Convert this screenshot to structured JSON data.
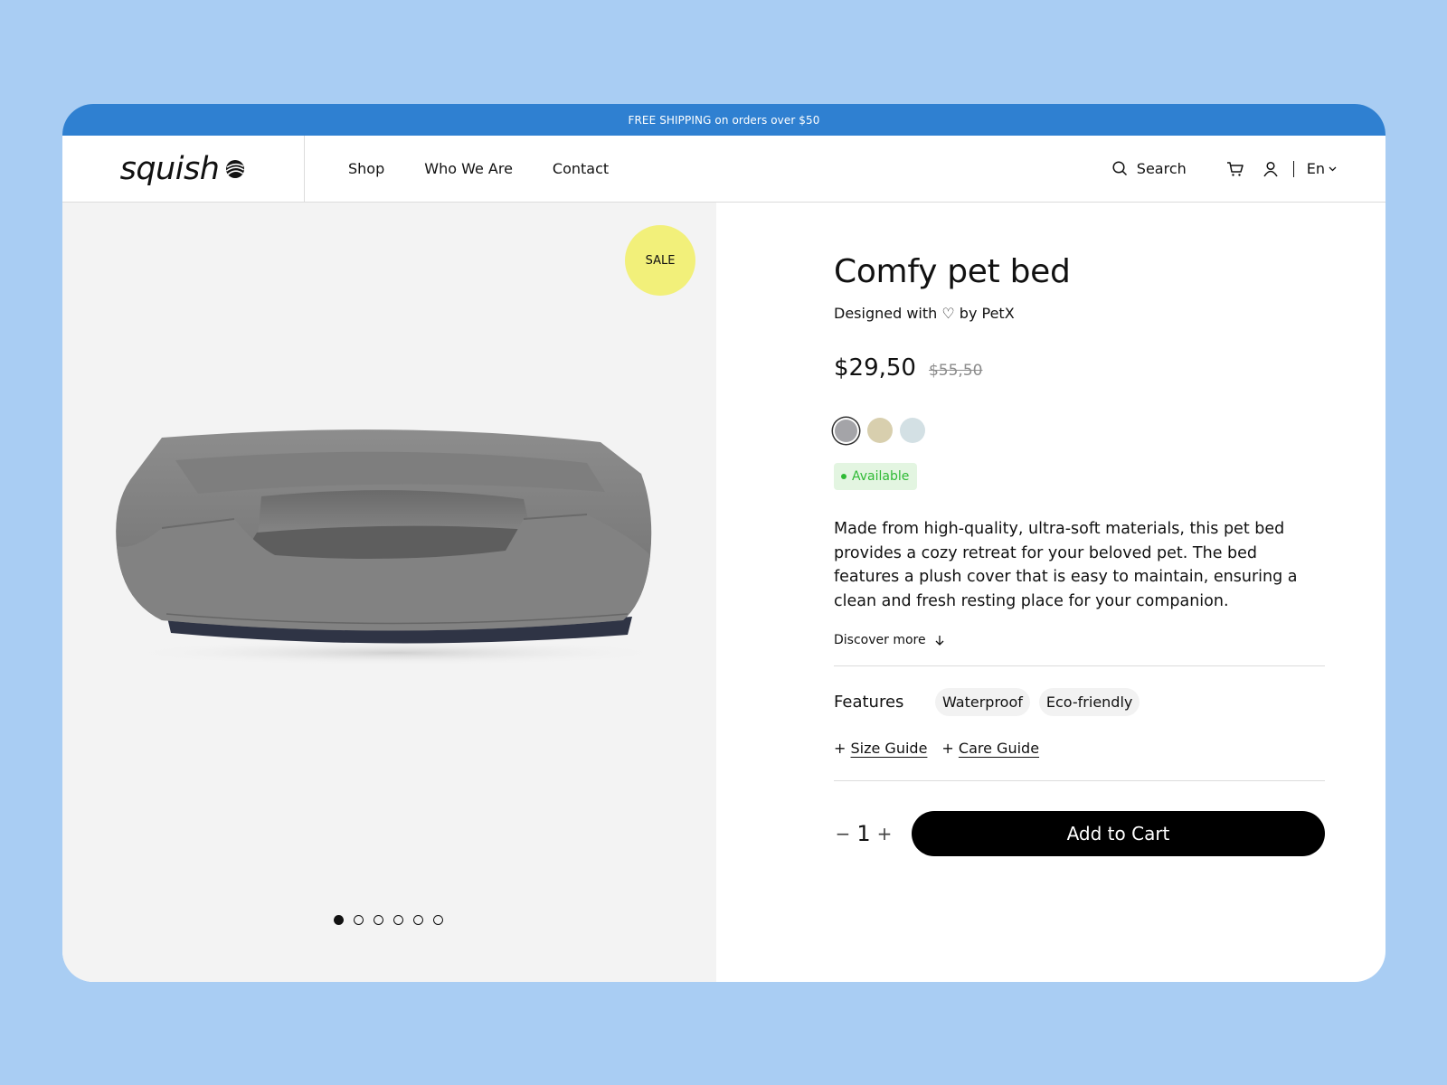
{
  "promo": {
    "text": "FREE SHIPPING on orders over $50"
  },
  "brand": {
    "logo_text": "squish"
  },
  "nav": {
    "links": [
      "Shop",
      "Who We Are",
      "Contact"
    ],
    "search_label": "Search",
    "language": "En"
  },
  "gallery": {
    "badge": "SALE",
    "slide_count": 6,
    "active_slide": 1
  },
  "product": {
    "title": "Comfy pet bed",
    "designer": "Designed with ♡ by PetX",
    "price": "$29,50",
    "old_price": "$55,50",
    "colors": [
      "#a4a4a8",
      "#d8cfae",
      "#d3e0e4"
    ],
    "selected_color": 0,
    "status": "Available",
    "description": "Made from high-quality, ultra-soft materials, this pet bed provides a cozy retreat for your beloved pet. The bed features a plush cover that is easy to maintain, ensuring a clean and fresh resting place for your companion.",
    "discover_label": "Discover more",
    "features_label": "Features",
    "features": [
      "Waterproof",
      "Eco-friendly"
    ],
    "guides": [
      "Size Guide",
      "Care Guide"
    ],
    "quantity": "1",
    "add_to_cart_label": "Add to Cart"
  },
  "colors": {
    "background": "#a9cdf3",
    "promo_bar": "#2f80d1",
    "sale_badge": "#f2f07a",
    "status_green": "#2fba35",
    "button": "#000000"
  }
}
